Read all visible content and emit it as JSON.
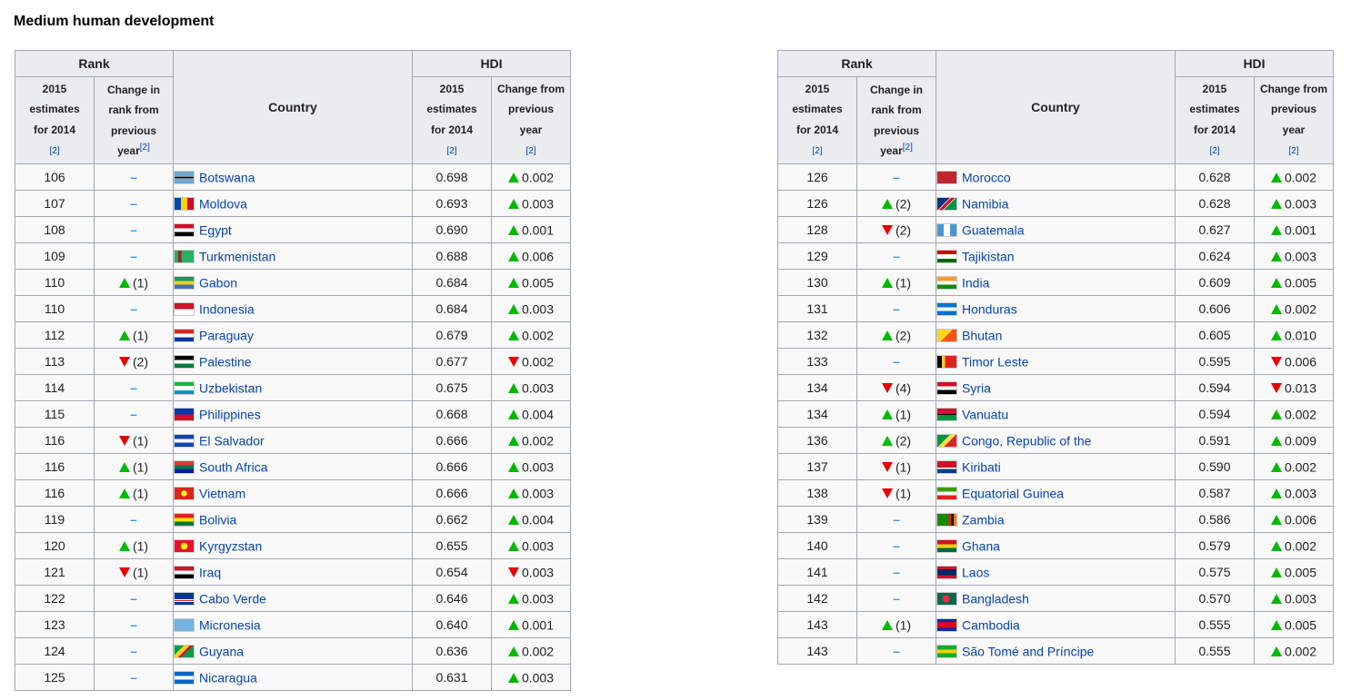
{
  "heading": "Medium human development",
  "headers": {
    "rank": "Rank",
    "hdi": "HDI",
    "country": "Country",
    "rank_est_lines": [
      "2015",
      "estimates",
      "for 2014"
    ],
    "rank_change_lines": [
      "Change in",
      "rank from",
      "previous",
      "year"
    ],
    "hdi_est_lines": [
      "2015",
      "estimates",
      "for 2014"
    ],
    "hdi_change_lines": [
      "Change from",
      "previous",
      "year"
    ],
    "ref": "[2]"
  },
  "colors": {
    "up": "#00b900",
    "down": "#e60000",
    "dash": "#3399ff",
    "link": "#0645ad"
  },
  "left_rows": [
    {
      "rank": "106",
      "dir": "none",
      "chg": "",
      "country": "Botswana",
      "flag": "linear-gradient(#6da9d2 0 40%, #fff 40% 44%, #000 44% 56%, #fff 56% 60%, #6da9d2 60%)",
      "hdi": "0.698",
      "hdir": "up",
      "hchg": "0.002"
    },
    {
      "rank": "107",
      "dir": "none",
      "chg": "",
      "country": "Moldova",
      "flag": "linear-gradient(90deg,#0046ae 0 33%,#ffd200 33% 66%,#cc092f 66%)",
      "hdi": "0.693",
      "hdir": "up",
      "hchg": "0.003"
    },
    {
      "rank": "108",
      "dir": "none",
      "chg": "",
      "country": "Egypt",
      "flag": "linear-gradient(#ce1126 0 33%,#fff 33% 66%,#000 66%)",
      "hdi": "0.690",
      "hdir": "up",
      "hchg": "0.001"
    },
    {
      "rank": "109",
      "dir": "none",
      "chg": "",
      "country": "Turkmenistan",
      "flag": "linear-gradient(90deg,#28ae66 0 20%,#a02020 20% 35%,#28ae66 35%)",
      "hdi": "0.688",
      "hdir": "up",
      "hchg": "0.006"
    },
    {
      "rank": "110",
      "dir": "up",
      "chg": "(1)",
      "country": "Gabon",
      "flag": "linear-gradient(#009e60 0 33%,#fcd116 33% 66%,#3a75c4 66%)",
      "hdi": "0.684",
      "hdir": "up",
      "hchg": "0.005"
    },
    {
      "rank": "110",
      "dir": "none",
      "chg": "",
      "country": "Indonesia",
      "flag": "linear-gradient(#ce1126 0 50%,#fff 50%)",
      "hdi": "0.684",
      "hdir": "up",
      "hchg": "0.003"
    },
    {
      "rank": "112",
      "dir": "up",
      "chg": "(1)",
      "country": "Paraguay",
      "flag": "linear-gradient(#d52b1e 0 33%,#fff 33% 66%,#0038a8 66%)",
      "hdi": "0.679",
      "hdir": "up",
      "hchg": "0.002"
    },
    {
      "rank": "113",
      "dir": "down",
      "chg": "(2)",
      "country": "Palestine",
      "flag": "linear-gradient(#000 0 33%,#fff 33% 66%,#007a3d 66%)",
      "hdi": "0.677",
      "hdir": "down",
      "hchg": "0.002"
    },
    {
      "rank": "114",
      "dir": "none",
      "chg": "",
      "country": "Uzbekistan",
      "flag": "linear-gradient(#1eb53a 0 30%,#fff 30% 70%,#0099b5 70%)",
      "hdi": "0.675",
      "hdir": "up",
      "hchg": "0.003"
    },
    {
      "rank": "115",
      "dir": "none",
      "chg": "",
      "country": "Philippines",
      "flag": "linear-gradient(#0038a8 0 50%,#ce1126 50%)",
      "hdi": "0.668",
      "hdir": "up",
      "hchg": "0.004"
    },
    {
      "rank": "116",
      "dir": "down",
      "chg": "(1)",
      "country": "El Salvador",
      "flag": "linear-gradient(#0f47af 0 33%,#fff 33% 66%,#0f47af 66%)",
      "hdi": "0.666",
      "hdir": "up",
      "hchg": "0.002"
    },
    {
      "rank": "116",
      "dir": "up",
      "chg": "(1)",
      "country": "South Africa",
      "flag": "linear-gradient(#de3831 0 33%,#007a4d 33% 66%,#002395 66%)",
      "hdi": "0.666",
      "hdir": "up",
      "hchg": "0.003"
    },
    {
      "rank": "116",
      "dir": "up",
      "chg": "(1)",
      "country": "Vietnam",
      "flag": "radial-gradient(circle,#ffff00 0 25%,#da251d 26%)",
      "hdi": "0.666",
      "hdir": "up",
      "hchg": "0.003"
    },
    {
      "rank": "119",
      "dir": "none",
      "chg": "",
      "country": "Bolivia",
      "flag": "linear-gradient(#d52b1e 0 33%,#f9e300 33% 66%,#007934 66%)",
      "hdi": "0.662",
      "hdir": "up",
      "hchg": "0.004"
    },
    {
      "rank": "120",
      "dir": "up",
      "chg": "(1)",
      "country": "Kyrgyzstan",
      "flag": "radial-gradient(circle,#ffef00 0 30%,#e8112d 31%)",
      "hdi": "0.655",
      "hdir": "up",
      "hchg": "0.003"
    },
    {
      "rank": "121",
      "dir": "down",
      "chg": "(1)",
      "country": "Iraq",
      "flag": "linear-gradient(#ce1126 0 33%,#fff 33% 66%,#000 66%)",
      "hdi": "0.654",
      "hdir": "down",
      "hchg": "0.003"
    },
    {
      "rank": "122",
      "dir": "none",
      "chg": "",
      "country": "Cabo Verde",
      "flag": "linear-gradient(#003893 0 55%,#fff 55% 62%,#cf2027 62% 70%,#fff 70% 77%,#003893 77%)",
      "hdi": "0.646",
      "hdir": "up",
      "hchg": "0.003"
    },
    {
      "rank": "123",
      "dir": "none",
      "chg": "",
      "country": "Micronesia",
      "flag": "linear-gradient(#75b2dd,#75b2dd)",
      "hdi": "0.640",
      "hdir": "up",
      "hchg": "0.001"
    },
    {
      "rank": "124",
      "dir": "none",
      "chg": "",
      "country": "Guyana",
      "flag": "linear-gradient(135deg,#009e49 0 30%,#fcd116 30% 50%,#ce1126 50% 60%,#009e49 60%)",
      "hdi": "0.636",
      "hdir": "up",
      "hchg": "0.002"
    },
    {
      "rank": "125",
      "dir": "none",
      "chg": "",
      "country": "Nicaragua",
      "flag": "linear-gradient(#0067c6 0 33%,#fff 33% 66%,#0067c6 66%)",
      "hdi": "0.631",
      "hdir": "up",
      "hchg": "0.003"
    }
  ],
  "right_rows": [
    {
      "rank": "126",
      "dir": "none",
      "chg": "",
      "country": "Morocco",
      "flag": "linear-gradient(#c1272d,#c1272d)",
      "hdi": "0.628",
      "hdir": "up",
      "hchg": "0.002"
    },
    {
      "rank": "126",
      "dir": "up",
      "chg": "(2)",
      "country": "Namibia",
      "flag": "linear-gradient(135deg,#003580 0 40%,#fff 40% 44%,#d21034 44% 56%,#fff 56% 60%,#009543 60%)",
      "hdi": "0.628",
      "hdir": "up",
      "hchg": "0.003"
    },
    {
      "rank": "128",
      "dir": "down",
      "chg": "(2)",
      "country": "Guatemala",
      "flag": "linear-gradient(90deg,#4997d0 0 33%,#fff 33% 66%,#4997d0 66%)",
      "hdi": "0.627",
      "hdir": "up",
      "hchg": "0.001"
    },
    {
      "rank": "129",
      "dir": "none",
      "chg": "",
      "country": "Tajikistan",
      "flag": "linear-gradient(#cc0000 0 30%,#fff 30% 70%,#006600 70%)",
      "hdi": "0.624",
      "hdir": "up",
      "hchg": "0.003"
    },
    {
      "rank": "130",
      "dir": "up",
      "chg": "(1)",
      "country": "India",
      "flag": "linear-gradient(#ff9933 0 33%,#fff 33% 66%,#138808 66%)",
      "hdi": "0.609",
      "hdir": "up",
      "hchg": "0.005"
    },
    {
      "rank": "131",
      "dir": "none",
      "chg": "",
      "country": "Honduras",
      "flag": "linear-gradient(#0073cf 0 33%,#fff 33% 66%,#0073cf 66%)",
      "hdi": "0.606",
      "hdir": "up",
      "hchg": "0.002"
    },
    {
      "rank": "132",
      "dir": "up",
      "chg": "(2)",
      "country": "Bhutan",
      "flag": "linear-gradient(135deg,#ffd520 0 50%,#ff4e12 50%)",
      "hdi": "0.605",
      "hdir": "up",
      "hchg": "0.010"
    },
    {
      "rank": "133",
      "dir": "none",
      "chg": "",
      "country": "Timor Leste",
      "flag": "linear-gradient(90deg,#000 0 25%,#ffc726 25% 40%,#dc241f 40%)",
      "hdi": "0.595",
      "hdir": "down",
      "hchg": "0.006"
    },
    {
      "rank": "134",
      "dir": "down",
      "chg": "(4)",
      "country": "Syria",
      "flag": "linear-gradient(#ce1126 0 33%,#fff 33% 66%,#000 66%)",
      "hdi": "0.594",
      "hdir": "down",
      "hchg": "0.013"
    },
    {
      "rank": "134",
      "dir": "up",
      "chg": "(1)",
      "country": "Vanuatu",
      "flag": "linear-gradient(#d21034 0 45%,#000 45% 55%,#009543 55%)",
      "hdi": "0.594",
      "hdir": "up",
      "hchg": "0.002"
    },
    {
      "rank": "136",
      "dir": "up",
      "chg": "(2)",
      "country": "Congo, Republic of the",
      "flag": "linear-gradient(135deg,#009543 0 40%,#fbde4a 40% 60%,#dc241f 60%)",
      "hdi": "0.591",
      "hdir": "up",
      "hchg": "0.009"
    },
    {
      "rank": "137",
      "dir": "down",
      "chg": "(1)",
      "country": "Kiribati",
      "flag": "linear-gradient(#ce1126 0 55%,#fff 55% 65%,#003f87 65%)",
      "hdi": "0.590",
      "hdir": "up",
      "hchg": "0.002"
    },
    {
      "rank": "138",
      "dir": "down",
      "chg": "(1)",
      "country": "Equatorial Guinea",
      "flag": "linear-gradient(#3e9a00 0 33%,#fff 33% 66%,#e32118 66%)",
      "hdi": "0.587",
      "hdir": "up",
      "hchg": "0.003"
    },
    {
      "rank": "139",
      "dir": "none",
      "chg": "",
      "country": "Zambia",
      "flag": "linear-gradient(90deg,#198a00 0 60%,#de2010 60% 73%,#000 73% 86%,#ef7d00 86%)",
      "hdi": "0.586",
      "hdir": "up",
      "hchg": "0.006"
    },
    {
      "rank": "140",
      "dir": "none",
      "chg": "",
      "country": "Ghana",
      "flag": "linear-gradient(#ce1126 0 33%,#fcd116 33% 66%,#006b3f 66%)",
      "hdi": "0.579",
      "hdir": "up",
      "hchg": "0.002"
    },
    {
      "rank": "141",
      "dir": "none",
      "chg": "",
      "country": "Laos",
      "flag": "linear-gradient(#ce1126 0 25%,#002868 25% 75%,#ce1126 75%)",
      "hdi": "0.575",
      "hdir": "up",
      "hchg": "0.005"
    },
    {
      "rank": "142",
      "dir": "none",
      "chg": "",
      "country": "Bangladesh",
      "flag": "radial-gradient(circle at 45% 50%,#f42a41 0 30%,#006a4e 31%)",
      "hdi": "0.570",
      "hdir": "up",
      "hchg": "0.003"
    },
    {
      "rank": "143",
      "dir": "up",
      "chg": "(1)",
      "country": "Cambodia",
      "flag": "linear-gradient(#032ea1 0 25%,#e00025 25% 75%,#032ea1 75%)",
      "hdi": "0.555",
      "hdir": "up",
      "hchg": "0.005"
    },
    {
      "rank": "143",
      "dir": "none",
      "chg": "",
      "country": "São Tomé and Príncipe",
      "flag": "linear-gradient(#12ad2b 0 33%,#ffce00 33% 66%,#12ad2b 66%)",
      "hdi": "0.555",
      "hdir": "up",
      "hchg": "0.002"
    }
  ]
}
